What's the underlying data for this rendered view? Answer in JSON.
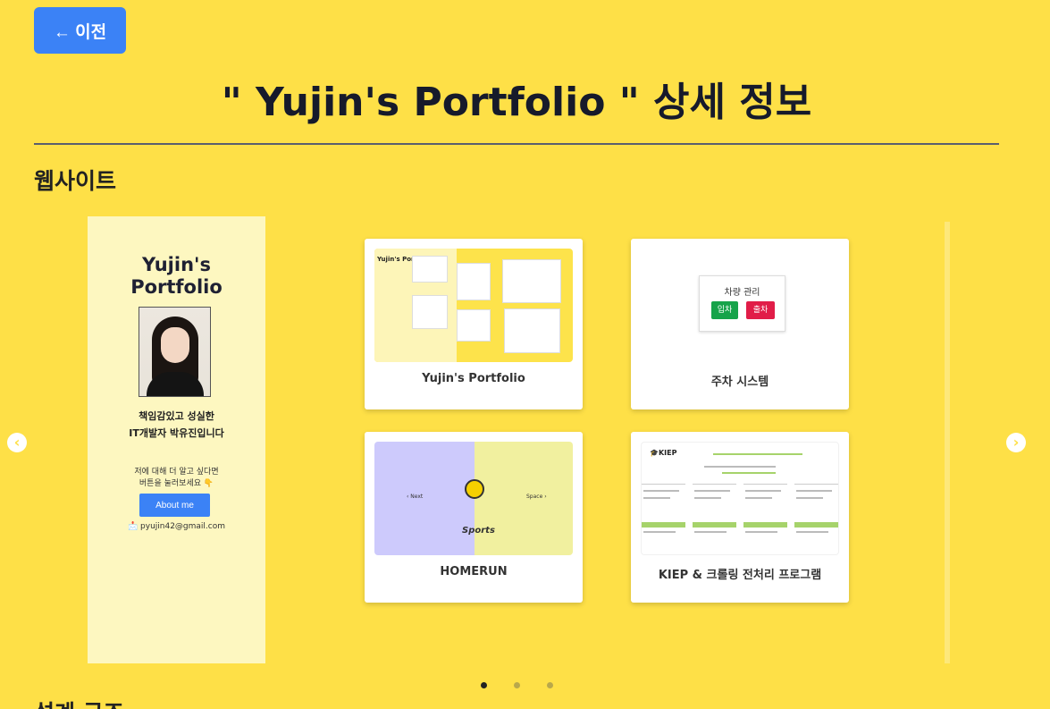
{
  "header": {
    "back_label": "← 이전",
    "title": "\" Yujin's Portfolio \" 상세 정보"
  },
  "sections": {
    "websites_title": "웹사이트",
    "next_title": "설계 구조"
  },
  "phone": {
    "title_line1": "Yujin's",
    "title_line2": "Portfolio",
    "intro_line1": "책임감있고 성실한",
    "intro_line2": "IT개발자 박유진입니다",
    "more_line1": "저에 대해 더 알고 싶다면",
    "more_line2": "버튼을 눌러보세요 👇",
    "about_label": "About me",
    "email": "📩 pyujin42@gmail.com"
  },
  "cards": [
    {
      "label": "Yujin's Portfolio",
      "thumb_text": "Yujin's Portfolio"
    },
    {
      "label": "주차 시스템",
      "thumb_title": "차량 관리",
      "in_label": "입차",
      "out_label": "출차"
    },
    {
      "label": "HOMERUN",
      "prev": "‹ Next",
      "next": "Space ›",
      "sports": "Sports"
    },
    {
      "label": "KIEP & 크롤링 전처리 프로그램",
      "logo": "🎓KIEP"
    }
  ],
  "carousel": {
    "prev_icon": "chevron-left-icon",
    "next_icon": "chevron-right-icon",
    "prev_glyph": "‹",
    "next_glyph": "›",
    "pages": 3,
    "active_page": 1
  },
  "colors": {
    "background": "#fee047",
    "accent": "#3b82f6",
    "in": "#16a34a",
    "out": "#e11d48"
  }
}
